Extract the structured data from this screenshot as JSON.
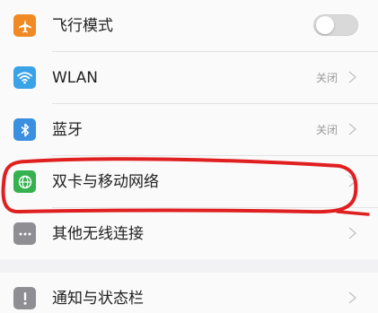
{
  "settings": {
    "rows": [
      {
        "label": "飞行模式",
        "icon": "airplane-icon",
        "color": "#f08a24",
        "control": "toggle",
        "on": false
      },
      {
        "label": "WLAN",
        "icon": "wifi-icon",
        "color": "#3aa3e8",
        "value": "关闭"
      },
      {
        "label": "蓝牙",
        "icon": "bluetooth-icon",
        "color": "#3a8fe0",
        "value": "关闭"
      },
      {
        "label": "双卡与移动网络",
        "icon": "globe-icon",
        "color": "#35b14f"
      },
      {
        "label": "其他无线连接",
        "icon": "more-icon",
        "color": "#8e8e93"
      }
    ],
    "rows2": [
      {
        "label": "通知与状态栏",
        "icon": "notification-icon",
        "color": "#8e8e93"
      }
    ]
  },
  "annotation": {
    "color": "#e02020"
  }
}
